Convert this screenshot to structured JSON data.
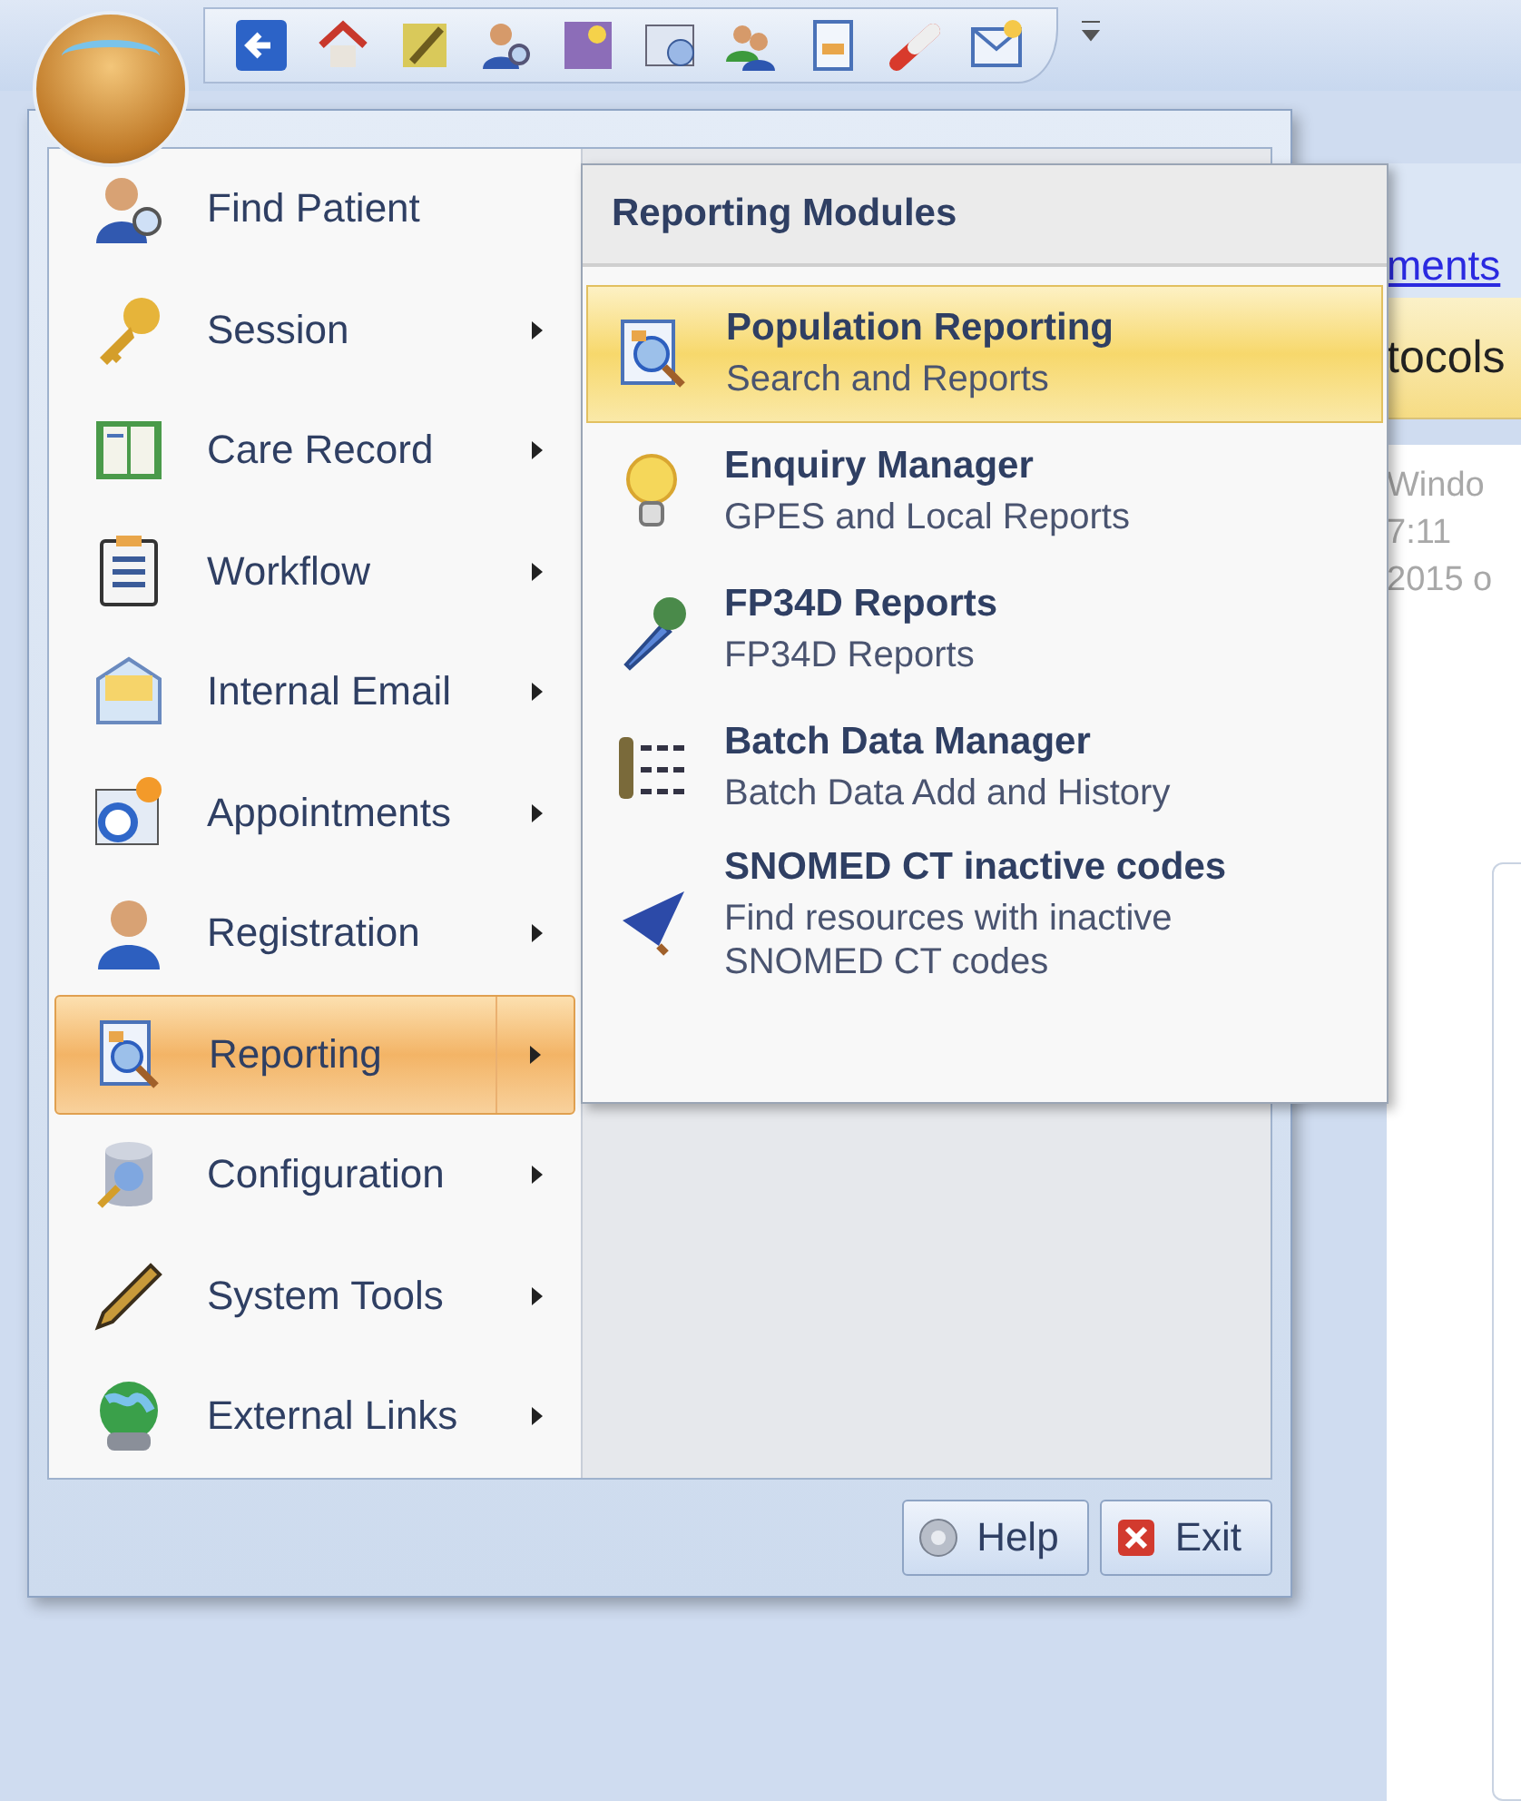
{
  "app_menu": {
    "items": [
      {
        "label": "Find Patient",
        "kind": "patient",
        "has_submenu": false,
        "selected": false
      },
      {
        "label": "Session",
        "kind": "key",
        "has_submenu": true,
        "selected": false
      },
      {
        "label": "Care Record",
        "kind": "book",
        "has_submenu": true,
        "selected": false
      },
      {
        "label": "Workflow",
        "kind": "list",
        "has_submenu": true,
        "selected": false
      },
      {
        "label": "Internal Email",
        "kind": "mail",
        "has_submenu": true,
        "selected": false
      },
      {
        "label": "Appointments",
        "kind": "calendar",
        "has_submenu": true,
        "selected": false
      },
      {
        "label": "Registration",
        "kind": "person",
        "has_submenu": true,
        "selected": false
      },
      {
        "label": "Reporting",
        "kind": "report",
        "has_submenu": true,
        "selected": true
      },
      {
        "label": "Configuration",
        "kind": "database",
        "has_submenu": true,
        "selected": false
      },
      {
        "label": "System Tools",
        "kind": "pencil",
        "has_submenu": true,
        "selected": false
      },
      {
        "label": "External Links",
        "kind": "globe",
        "has_submenu": true,
        "selected": false
      }
    ],
    "help_button": "Help",
    "exit_button": "Exit"
  },
  "submenu": {
    "title": "Reporting Modules",
    "items": [
      {
        "title": "Population Reporting",
        "subtitle": "Search and Reports",
        "kind": "report",
        "selected": true
      },
      {
        "title": "Enquiry Manager",
        "subtitle": "GPES and Local Reports",
        "kind": "bulb",
        "selected": false
      },
      {
        "title": "FP34D Reports",
        "subtitle": "FP34D Reports",
        "kind": "dropper",
        "selected": false
      },
      {
        "title": "Batch Data Manager",
        "subtitle": "Batch Data Add and History",
        "kind": "batch",
        "selected": false
      },
      {
        "title": "SNOMED CT inactive codes",
        "subtitle": "Find resources with inactive SNOMED CT codes",
        "kind": "wizard",
        "selected": false
      }
    ]
  },
  "background": {
    "link": "ments",
    "tab": "tocols",
    "lines": [
      "Windo",
      "7:11",
      "2015 o"
    ]
  }
}
